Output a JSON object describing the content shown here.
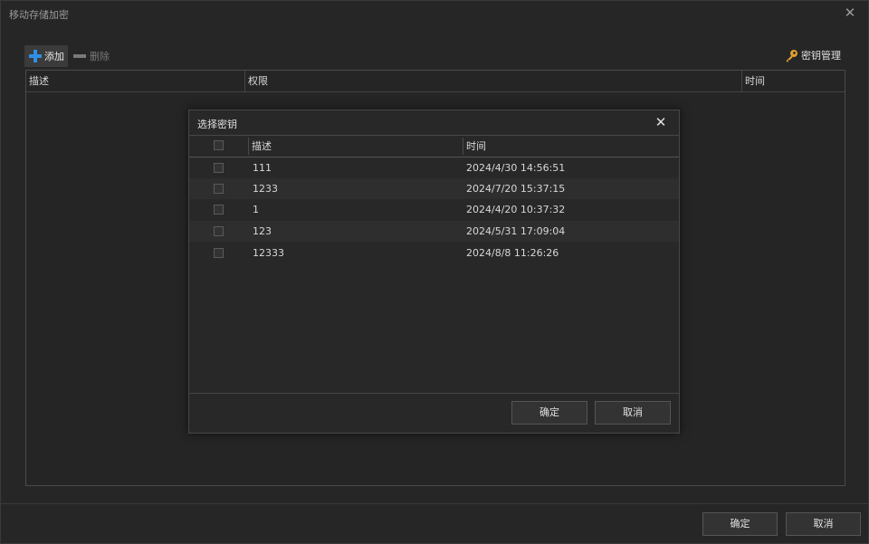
{
  "window": {
    "title": "移动存储加密",
    "close_symbol": "✕"
  },
  "toolbar": {
    "add_label": "添加",
    "delete_label": "删除",
    "key_manage_label": "密钥管理"
  },
  "main_table": {
    "columns": [
      "描述",
      "权限",
      "时间"
    ]
  },
  "footer": {
    "ok_label": "确定",
    "cancel_label": "取消"
  },
  "dialog": {
    "title": "选择密钥",
    "close_symbol": "✕",
    "columns": [
      "描述",
      "时间"
    ],
    "rows": [
      {
        "desc": "111",
        "time": "2024/4/30 14:56:51"
      },
      {
        "desc": "1233",
        "time": "2024/7/20 15:37:15"
      },
      {
        "desc": "1",
        "time": "2024/4/20 10:37:32"
      },
      {
        "desc": "123",
        "time": "2024/5/31 17:09:04"
      },
      {
        "desc": "12333",
        "time": "2024/8/8 11:26:26"
      }
    ],
    "ok_label": "确定",
    "cancel_label": "取消"
  },
  "colors": {
    "accent_blue": "#2f8fe6",
    "key_gold": "#e0a030",
    "background": "#262626"
  },
  "icons": {
    "add": "plus-icon",
    "delete": "minus-icon",
    "key": "key-icon",
    "close": "close-icon"
  }
}
